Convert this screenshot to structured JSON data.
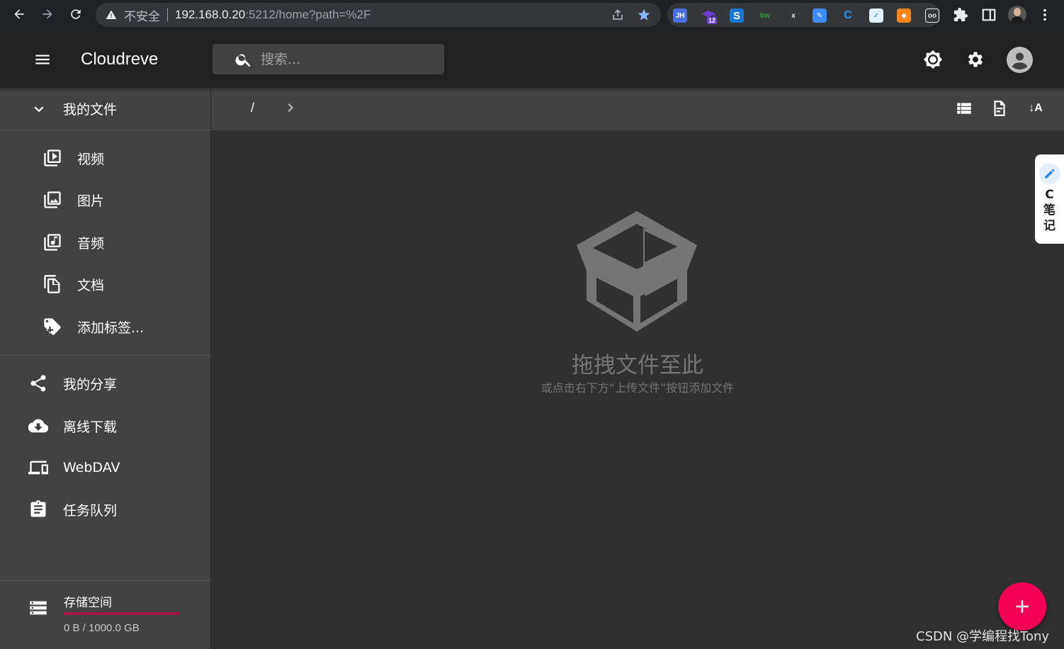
{
  "browser": {
    "insecure_label": "不安全",
    "url_host": "192.168.0.20",
    "url_rest": ":5212/home?path=%2F",
    "ext_badge": "12"
  },
  "appbar": {
    "title": "Cloudreve",
    "search_placeholder": "搜索..."
  },
  "sidebar": {
    "my_files": "我的文件",
    "sub_items": [
      {
        "label": "视频"
      },
      {
        "label": "图片"
      },
      {
        "label": "音频"
      },
      {
        "label": "文档"
      },
      {
        "label": "添加标签..."
      }
    ],
    "items": [
      {
        "label": "我的分享"
      },
      {
        "label": "离线下载"
      },
      {
        "label": "WebDAV"
      },
      {
        "label": "任务队列"
      }
    ],
    "storage": {
      "label": "存储空间",
      "usage": "0 B / 1000.0 GB",
      "fraction_used": 0.0
    }
  },
  "toolbar": {
    "breadcrumb_root": "/",
    "sort_label": "↓A"
  },
  "empty": {
    "title": "拖拽文件至此",
    "subtitle": "或点击右下方“上传文件”按钮添加文件"
  },
  "note_tab": {
    "text": "C笔记"
  },
  "watermark": "CSDN @学编程找Tony",
  "colors": {
    "accent": "#f50057",
    "appbar": "#212121",
    "sidebar": "#424242",
    "content": "#303030",
    "storage_bar": "#a01846"
  }
}
